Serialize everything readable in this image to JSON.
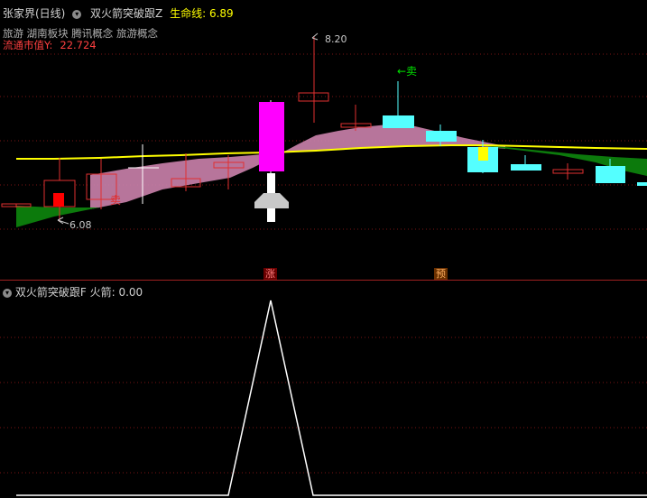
{
  "main_panel": {
    "title": "张家界(日线)",
    "indicator_name": "双火箭突破跟Z",
    "lifeline_label": "生命线:",
    "lifeline_value": "6.89",
    "concepts": "旅游 湖南板块 腾讯概念 旅游概念",
    "market_cap_label": "流通市值Y:",
    "market_cap_value": "22.724",
    "price_high_label": "8.20",
    "price_low_label": "6.08",
    "sell_labels": [
      "卖",
      "←卖"
    ],
    "markers": {
      "zhang": "涨",
      "yu": "预"
    }
  },
  "sub_panel": {
    "indicator_name": "双火箭突破跟F",
    "value_label": "火箭:",
    "value": "0.00"
  },
  "colors": {
    "background": "#000000",
    "up_candle": "#e03030",
    "down_candle": "#54ffff",
    "lifeline": "#ffff00",
    "band_up": "#c77fa8",
    "band_down": "#0c7a0c",
    "rocket_candle": "#ff00ff",
    "grid": "#8b1a1a"
  }
}
